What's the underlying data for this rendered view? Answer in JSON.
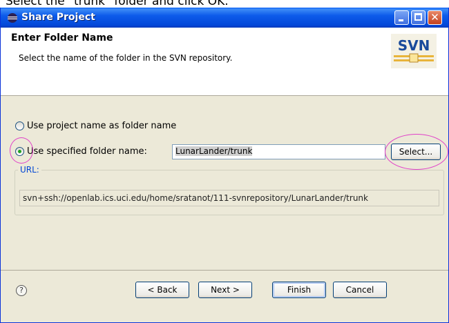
{
  "caption": "Select the \"trunk\" folder and click OK.",
  "window": {
    "title": "Share Project"
  },
  "header": {
    "title": "Enter Folder Name",
    "description": "Select the name of the folder in the SVN repository.",
    "logo_text": "SVN"
  },
  "options": {
    "use_project_name": {
      "label": "Use project name as folder name",
      "selected": false
    },
    "use_specified_name": {
      "label": "Use specified folder name:",
      "selected": true
    },
    "folder_name_value": "LunarLander/trunk",
    "select_button": "Select..."
  },
  "url": {
    "group_label": "URL:",
    "value": "svn+ssh://openlab.ics.uci.edu/home/sratanot/111-svnrepository/LunarLander/trunk"
  },
  "footer": {
    "help_glyph": "?",
    "back": "< Back",
    "next": "Next >",
    "finish": "Finish",
    "cancel": "Cancel"
  },
  "colors": {
    "titlebar": "#0a5ff5",
    "annotation_circle": "#e040c8",
    "url_label": "#0046d5"
  }
}
